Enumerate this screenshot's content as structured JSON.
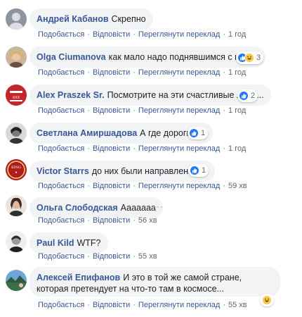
{
  "actions": {
    "like": "Подобається",
    "reply": "Відповісти",
    "translate": "Переглянути переклад"
  },
  "more_label": "···",
  "comments": [
    {
      "author": "Андрей Кабанов",
      "text": "Скрепно",
      "time": "1 год",
      "reactions": null,
      "avatar": "grey-profile"
    },
    {
      "author": "Olga Ciumanova",
      "text": "как мало надо поднявшимся с колен",
      "time": "1 год",
      "reactions": "3",
      "avatar": "blonde-woman"
    },
    {
      "author": "Alex Praszek Sr.",
      "text": "Посмотрите на эти счастливые лица...",
      "time": "1 год",
      "reactions": "2",
      "avatar": "dutch-tutor-logo"
    },
    {
      "author": "Светлана Амиршадова",
      "text": "А где дороги???",
      "time": "1 год",
      "reactions": "1",
      "avatar": "bw-portrait"
    },
    {
      "author": "Victor Starrs",
      "text": "до них были направления....",
      "time": "59 хв",
      "reactions": "1",
      "avatar": "king-of-spades"
    },
    {
      "author": "Ольга Слободская",
      "text": "Ааааааа",
      "time": "56 хв",
      "reactions": null,
      "avatar": "woman-portrait"
    },
    {
      "author": "Paul Kild",
      "text": "WTF?",
      "time": "55 хв",
      "reactions": null,
      "avatar": "man-portrait"
    },
    {
      "author": "Алексей Епифанов",
      "text": "И это в той же самой стране, которая претендует на что-то там в космосе...",
      "time": "55 хв",
      "reactions": null,
      "avatar": "landscape-photo"
    }
  ]
}
